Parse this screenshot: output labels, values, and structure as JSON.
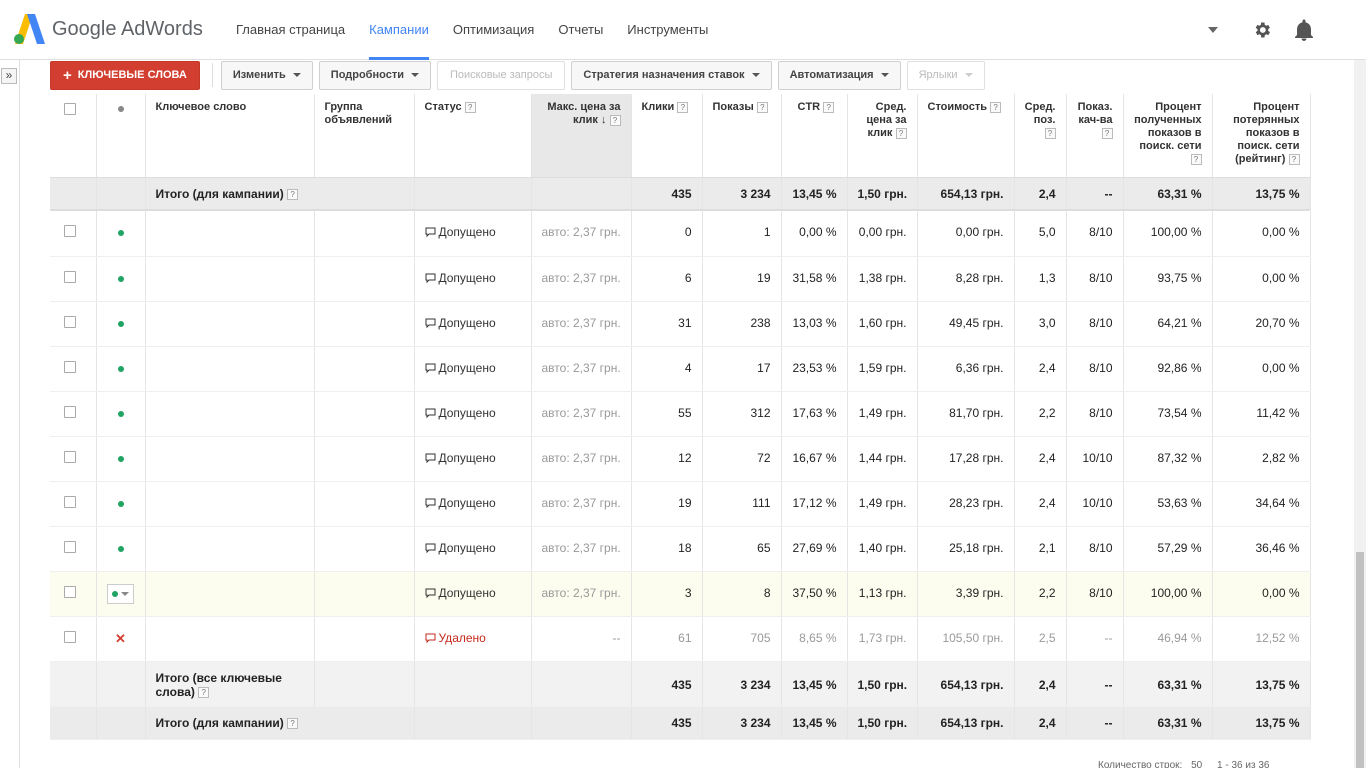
{
  "header": {
    "logo_text": "Google AdWords",
    "nav": [
      {
        "label": "Главная страница",
        "active": false
      },
      {
        "label": "Кампании",
        "active": true
      },
      {
        "label": "Оптимизация",
        "active": false
      },
      {
        "label": "Отчеты",
        "active": false
      },
      {
        "label": "Инструменты",
        "active": false
      }
    ],
    "icons": [
      "gear-icon",
      "bell-icon"
    ]
  },
  "side_toggle": "»",
  "toolbar": {
    "add_keywords": "КЛЮЧЕВЫЕ СЛОВА",
    "edit": "Изменить",
    "details": "Подробности",
    "search_terms": "Поисковые запросы",
    "bid_strategy": "Стратегия назначения ставок",
    "automate": "Автоматизация",
    "labels": "Ярлыки"
  },
  "columns": {
    "keyword": "Ключевое слово",
    "ad_group": "Группа объявлений",
    "status": "Статус",
    "max_cpc": "Макс. цена за клик",
    "clicks": "Клики",
    "impressions": "Показы",
    "ctr": "CTR",
    "avg_cpc": "Сред. цена за клик",
    "cost": "Стоимость",
    "avg_pos": "Сред. поз.",
    "quality": "Показ. кач-ва",
    "imp_share": "Процент полученных показов в поиск. сети",
    "lost_imp_share": "Процент потерянных показов в поиск. сети (рейтинг)"
  },
  "total_campaign_top": {
    "label": "Итого (для кампании)",
    "clicks": "435",
    "impressions": "3 234",
    "ctr": "13,45 %",
    "avg_cpc": "1,50 грн.",
    "cost": "654,13 грн.",
    "avg_pos": "2,4",
    "quality": "--",
    "imp_share": "63,31 %",
    "lost": "13,75 %"
  },
  "rows": [
    {
      "status": "Допущено",
      "bid": "авто: 2,37 грн.",
      "clicks": "0",
      "impr": "1",
      "ctr": "0,00 %",
      "cpc": "0,00 грн.",
      "cost": "0,00 грн.",
      "pos": "5,0",
      "qs": "8/10",
      "share": "100,00 %",
      "lost": "0,00 %"
    },
    {
      "status": "Допущено",
      "bid": "авто: 2,37 грн.",
      "clicks": "6",
      "impr": "19",
      "ctr": "31,58 %",
      "cpc": "1,38 грн.",
      "cost": "8,28 грн.",
      "pos": "1,3",
      "qs": "8/10",
      "share": "93,75 %",
      "lost": "0,00 %"
    },
    {
      "status": "Допущено",
      "bid": "авто: 2,37 грн.",
      "clicks": "31",
      "impr": "238",
      "ctr": "13,03 %",
      "cpc": "1,60 грн.",
      "cost": "49,45 грн.",
      "pos": "3,0",
      "qs": "8/10",
      "share": "64,21 %",
      "lost": "20,70 %"
    },
    {
      "status": "Допущено",
      "bid": "авто: 2,37 грн.",
      "clicks": "4",
      "impr": "17",
      "ctr": "23,53 %",
      "cpc": "1,59 грн.",
      "cost": "6,36 грн.",
      "pos": "2,4",
      "qs": "8/10",
      "share": "92,86 %",
      "lost": "0,00 %"
    },
    {
      "status": "Допущено",
      "bid": "авто: 2,37 грн.",
      "clicks": "55",
      "impr": "312",
      "ctr": "17,63 %",
      "cpc": "1,49 грн.",
      "cost": "81,70 грн.",
      "pos": "2,2",
      "qs": "8/10",
      "share": "73,54 %",
      "lost": "11,42 %"
    },
    {
      "status": "Допущено",
      "bid": "авто: 2,37 грн.",
      "clicks": "12",
      "impr": "72",
      "ctr": "16,67 %",
      "cpc": "1,44 грн.",
      "cost": "17,28 грн.",
      "pos": "2,4",
      "qs": "10/10",
      "share": "87,32 %",
      "lost": "2,82 %"
    },
    {
      "status": "Допущено",
      "bid": "авто: 2,37 грн.",
      "clicks": "19",
      "impr": "111",
      "ctr": "17,12 %",
      "cpc": "1,49 грн.",
      "cost": "28,23 грн.",
      "pos": "2,4",
      "qs": "10/10",
      "share": "53,63 %",
      "lost": "34,64 %"
    },
    {
      "status": "Допущено",
      "bid": "авто: 2,37 грн.",
      "clicks": "18",
      "impr": "65",
      "ctr": "27,69 %",
      "cpc": "1,40 грн.",
      "cost": "25,18 грн.",
      "pos": "2,1",
      "qs": "8/10",
      "share": "57,29 %",
      "lost": "36,46 %"
    },
    {
      "status": "Допущено",
      "bid": "авто: 2,37 грн.",
      "clicks": "3",
      "impr": "8",
      "ctr": "37,50 %",
      "cpc": "1,13 грн.",
      "cost": "3,39 грн.",
      "pos": "2,2",
      "qs": "8/10",
      "share": "100,00 %",
      "lost": "0,00 %"
    },
    {
      "status": "Удалено",
      "bid": "--",
      "clicks": "61",
      "impr": "705",
      "ctr": "8,65 %",
      "cpc": "1,73 грн.",
      "cost": "105,50 грн.",
      "pos": "2,5",
      "qs": "--",
      "share": "46,94 %",
      "lost": "12,52 %"
    }
  ],
  "total_keywords": {
    "label": "Итого (все ключевые слова)",
    "clicks": "435",
    "impressions": "3 234",
    "ctr": "13,45 %",
    "avg_cpc": "1,50 грн.",
    "cost": "654,13 грн.",
    "avg_pos": "2,4",
    "quality": "--",
    "imp_share": "63,31 %",
    "lost": "13,75 %"
  },
  "total_campaign_bottom": {
    "label": "Итого (для кампании)",
    "clicks": "435",
    "impressions": "3 234",
    "ctr": "13,45 %",
    "avg_cpc": "1,50 грн.",
    "cost": "654,13 грн.",
    "avg_pos": "2,4",
    "quality": "--",
    "imp_share": "63,31 %",
    "lost": "13,75 %"
  },
  "pager": {
    "rows_label": "Количество строк:",
    "rows_value": "50",
    "range": "1 - 36 из 36"
  },
  "colors": {
    "accent": "#4285f4",
    "primary_button": "#d23f31",
    "enabled_dot": "#1fa463",
    "removed": "#c5291c"
  }
}
